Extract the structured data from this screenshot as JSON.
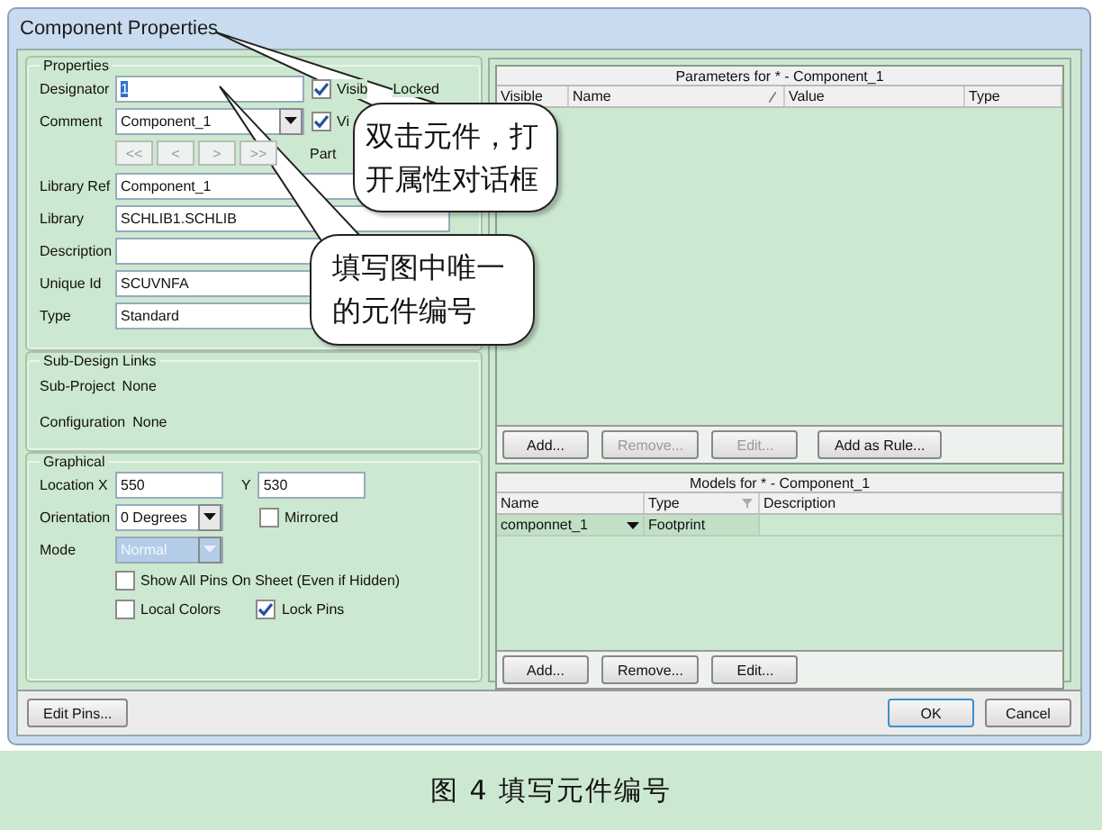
{
  "window": {
    "title": "Component Properties"
  },
  "properties": {
    "legend": "Properties",
    "designator": {
      "label": "Designator",
      "value": "1",
      "highlighted": true,
      "visible": {
        "label": "Visib",
        "checked": true
      },
      "locked": {
        "label": "Locked"
      }
    },
    "comment": {
      "label": "Comment",
      "value": "Component_1",
      "visible": {
        "label": "Vi",
        "checked": true
      }
    },
    "part_nav": {
      "buttons": [
        "<<",
        "<",
        ">",
        ">>"
      ],
      "label": "Part"
    },
    "fields": [
      {
        "label": "Library Ref",
        "value": "Component_1"
      },
      {
        "label": "Library",
        "value": "SCHLIB1.SCHLIB"
      },
      {
        "label": "Description"
      },
      {
        "label": "Unique Id",
        "value": "SCUVNFA"
      },
      {
        "label": "Type",
        "value": "Standard"
      }
    ]
  },
  "sub_design": {
    "legend": "Sub-Design Links",
    "rows": [
      {
        "label": "Sub-Project",
        "value": "None"
      },
      {
        "label": "Configuration",
        "value": "None"
      }
    ]
  },
  "graphical": {
    "legend": "Graphical",
    "location_x": {
      "label": "Location X",
      "value": "550"
    },
    "location_y": {
      "label": "Y",
      "value": "530"
    },
    "orientation": {
      "label": "Orientation",
      "value": "0 Degrees"
    },
    "mirrored": {
      "label": "Mirrored",
      "checked": false
    },
    "mode": {
      "label": "Mode",
      "value": "Normal",
      "disabled": true
    },
    "checks": [
      {
        "label": "Show All Pins On Sheet (Even if Hidden)",
        "checked": false
      },
      {
        "label": "Local Colors",
        "checked": false
      },
      {
        "label": "Lock Pins",
        "checked": true
      }
    ]
  },
  "parameters": {
    "title": "Parameters for * - Component_1",
    "columns": [
      "Visible",
      "Name",
      "Value",
      "Type"
    ],
    "buttons": [
      {
        "label": "Add...",
        "disabled": false
      },
      {
        "label": "Remove...",
        "disabled": true
      },
      {
        "label": "Edit...",
        "disabled": true
      },
      {
        "label": "Add as Rule...",
        "disabled": false
      }
    ]
  },
  "models": {
    "title": "Models for * - Component_1",
    "columns": [
      "Name",
      "Type",
      "Description"
    ],
    "rows": [
      {
        "name": "componnet_1",
        "type": "Footprint"
      }
    ],
    "buttons": [
      {
        "label": "Add...",
        "disabled": false
      },
      {
        "label": "Remove...",
        "disabled": false
      },
      {
        "label": "Edit...",
        "disabled": false
      }
    ]
  },
  "footer": {
    "edit_pins": "Edit Pins...",
    "ok": {
      "label": "OK",
      "default": true
    },
    "cancel": {
      "label": "Cancel",
      "default": false
    }
  },
  "callouts": [
    {
      "text": "双击元件，打开属性对话框"
    },
    {
      "text": "填写图中唯一的元件编号"
    }
  ],
  "caption": "图 4 填写元件编号"
}
